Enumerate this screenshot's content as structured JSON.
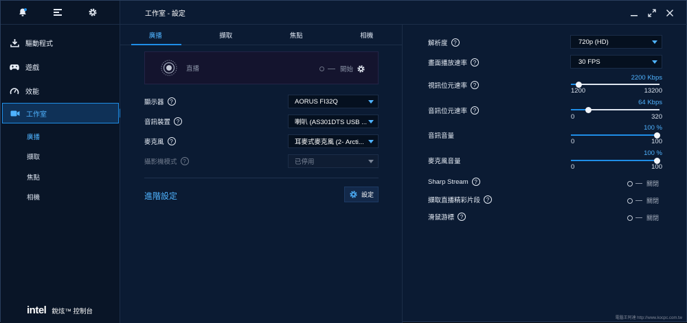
{
  "window": {
    "title": "工作室 - 設定"
  },
  "sidebar": {
    "items": [
      {
        "label": "驅動程式",
        "icon": "download-icon"
      },
      {
        "label": "遊戲",
        "icon": "gamepad-icon"
      },
      {
        "label": "效能",
        "icon": "gauge-icon"
      },
      {
        "label": "工作室",
        "icon": "camera-icon",
        "active": true
      }
    ],
    "sub_items": [
      {
        "label": "廣播",
        "active": true
      },
      {
        "label": "擷取"
      },
      {
        "label": "焦點"
      },
      {
        "label": "相機"
      }
    ],
    "brand": {
      "logo": "intel",
      "text": "銳炫™ 控制台"
    }
  },
  "tabs": [
    {
      "label": "廣播",
      "active": true
    },
    {
      "label": "擷取"
    },
    {
      "label": "焦點"
    },
    {
      "label": "相機"
    }
  ],
  "stream": {
    "label": "直播",
    "start_label": "開始"
  },
  "form": {
    "display": {
      "label": "顯示器",
      "value": "AORUS FI32Q"
    },
    "audio_device": {
      "label": "音訊裝置",
      "value": "喇叭 (AS301DTS USB ..."
    },
    "microphone": {
      "label": "麥克風",
      "value": "耳麥式麥克風 (2- Arcti..."
    },
    "camera_mode": {
      "label": "攝影機模式",
      "value": "已停用",
      "disabled": true
    }
  },
  "advanced": {
    "link": "進階設定",
    "button": "設定"
  },
  "settings": {
    "resolution": {
      "label": "解析度",
      "value": "720p (HD)"
    },
    "framerate": {
      "label": "畫面播放速率",
      "value": "30 FPS"
    },
    "video_bitrate": {
      "label": "視訊位元速率",
      "value": "2200 Kbps",
      "min": "1200",
      "max": "13200",
      "level": 0.09
    },
    "audio_bitrate": {
      "label": "音訊位元速率",
      "value": "64 Kbps",
      "min": "0",
      "max": "320",
      "level": 0.2
    },
    "audio_volume": {
      "label": "音訊音量",
      "value": "100 %",
      "min": "0",
      "max": "100",
      "level": 1.0
    },
    "mic_volume": {
      "label": "麥克風音量",
      "value": "100 %",
      "min": "0",
      "max": "100",
      "level": 1.0
    },
    "sharp_stream": {
      "label": "Sharp Stream",
      "state": "關閉"
    },
    "capture_highlights": {
      "label": "擷取直播精彩片段",
      "state": "關閉"
    },
    "mouse_cursor": {
      "label": "滑鼠游標",
      "state": "關閉"
    }
  },
  "watermark": "電腦王阿達 http://www.kocpc.com.tw",
  "colors": {
    "accent": "#1f8ee8",
    "background": "#0b1b33",
    "sidebar": "#091527"
  }
}
